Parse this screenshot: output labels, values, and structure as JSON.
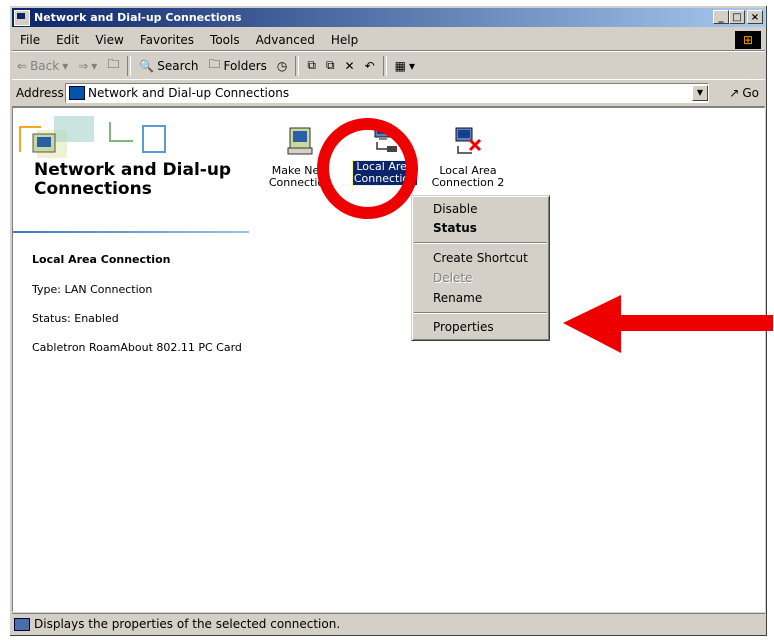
{
  "window": {
    "title": "Network and Dial-up Connections",
    "buttons": [
      "_",
      "□",
      "×"
    ]
  },
  "menu": [
    "File",
    "Edit",
    "View",
    "Favorites",
    "Tools",
    "Advanced",
    "Help"
  ],
  "toolbar": {
    "back": "Back",
    "search": "Search",
    "folders": "Folders"
  },
  "address": {
    "label": "Address",
    "value": "Network and Dial-up Connections",
    "go": "Go"
  },
  "left_panel": {
    "title": "Network and Dial-up Connections",
    "selected_name": "Local Area Connection",
    "type": "Type: LAN Connection",
    "status": "Status: Enabled",
    "device": "Cabletron RoamAbout 802.11 PC Card"
  },
  "icons": [
    {
      "line1": "Make New",
      "line2": "Connection"
    },
    {
      "line1": "Local Area",
      "line2": "Connection"
    },
    {
      "line1": "Local Area",
      "line2": "Connection 2"
    }
  ],
  "context_menu": {
    "disable": "Disable",
    "status": "Status",
    "create_shortcut": "Create Shortcut",
    "delete": "Delete",
    "rename": "Rename",
    "properties": "Properties"
  },
  "statusbar": "Displays the properties of the selected connection.",
  "colors": {
    "title_active": "#0a246a",
    "annotation_red": "#ee0000",
    "face": "#d4d0c8"
  }
}
